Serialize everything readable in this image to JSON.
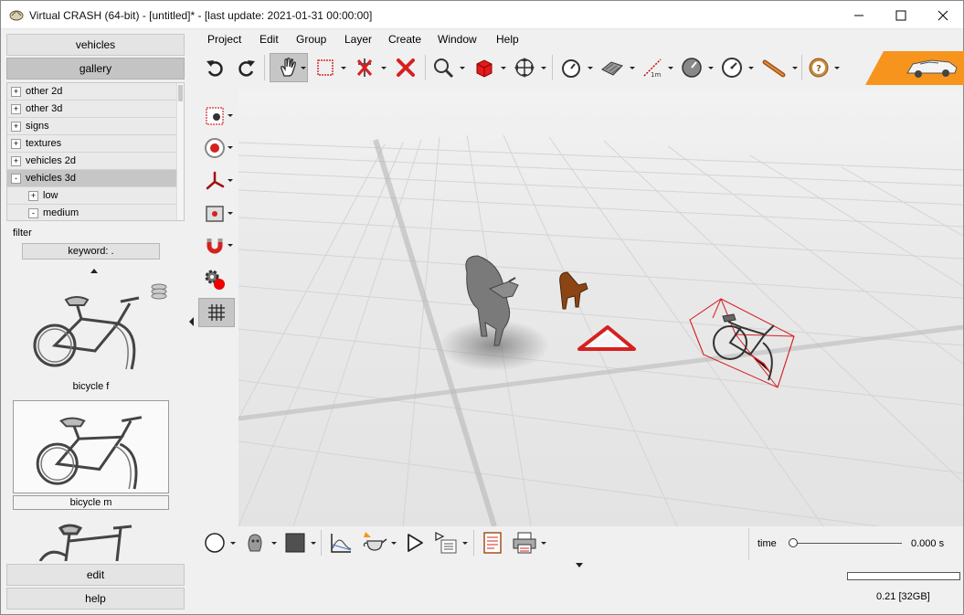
{
  "window": {
    "title": "Virtual CRASH (64-bit) - [untitled]* -   [last update: 2021-01-31 00:00:00]",
    "minimize_glyph": "minimize-icon",
    "maximize_glyph": "maximize-icon",
    "close_glyph": "close-icon"
  },
  "left_panel": {
    "tabs": {
      "vehicles": "vehicles",
      "gallery": "gallery",
      "edit": "edit",
      "help": "help"
    },
    "tree": [
      {
        "toggle": "+",
        "label": "other 2d",
        "level": 0
      },
      {
        "toggle": "+",
        "label": "other 3d",
        "level": 0
      },
      {
        "toggle": "+",
        "label": "signs",
        "level": 0
      },
      {
        "toggle": "+",
        "label": "textures",
        "level": 0
      },
      {
        "toggle": "+",
        "label": "vehicles 2d",
        "level": 0
      },
      {
        "toggle": "-",
        "label": "vehicles 3d",
        "level": 0,
        "selected": true
      },
      {
        "toggle": "+",
        "label": "low",
        "level": 1
      },
      {
        "toggle": "-",
        "label": "medium",
        "level": 1
      }
    ],
    "filter_label": "filter",
    "keyword_value": "keyword: .",
    "gallery_items": [
      {
        "caption": "bicycle f",
        "selected": false
      },
      {
        "caption": "bicycle m",
        "selected": true
      }
    ]
  },
  "menu": [
    "Project",
    "Edit",
    "Group",
    "Layer",
    "Create",
    "Window",
    "Help"
  ],
  "toolbar_icons": [
    "undo-icon",
    "redo-icon",
    "pan-hand-icon",
    "select-rect-icon",
    "delete-point-icon",
    "delete-icon",
    "zoom-icon",
    "cube-icon",
    "move-view-icon",
    "stopwatch-icon",
    "surface-icon",
    "measure-icon",
    "gauge-icon",
    "speedometer-icon",
    "sign-post-icon",
    "help-icon"
  ],
  "side_tools": [
    "record-icon",
    "target-icon",
    "axes-icon",
    "camera-icon",
    "magnet-icon",
    "settings-record-icon",
    "grid-icon"
  ],
  "bottom_tools": [
    "circle-icon",
    "head-icon",
    "color-swatch-icon",
    "graph-icon",
    "teapot-icon",
    "play-icon",
    "script-icon",
    "report-icon",
    "print-icon"
  ],
  "status": {
    "time_label": "time",
    "time_value": "0.000 s",
    "time_position": 0.0,
    "progress": 0.0,
    "memory": "0.21 [32GB]"
  },
  "colors": {
    "brand_orange": "#f7941d",
    "accent_red": "#d62020"
  }
}
